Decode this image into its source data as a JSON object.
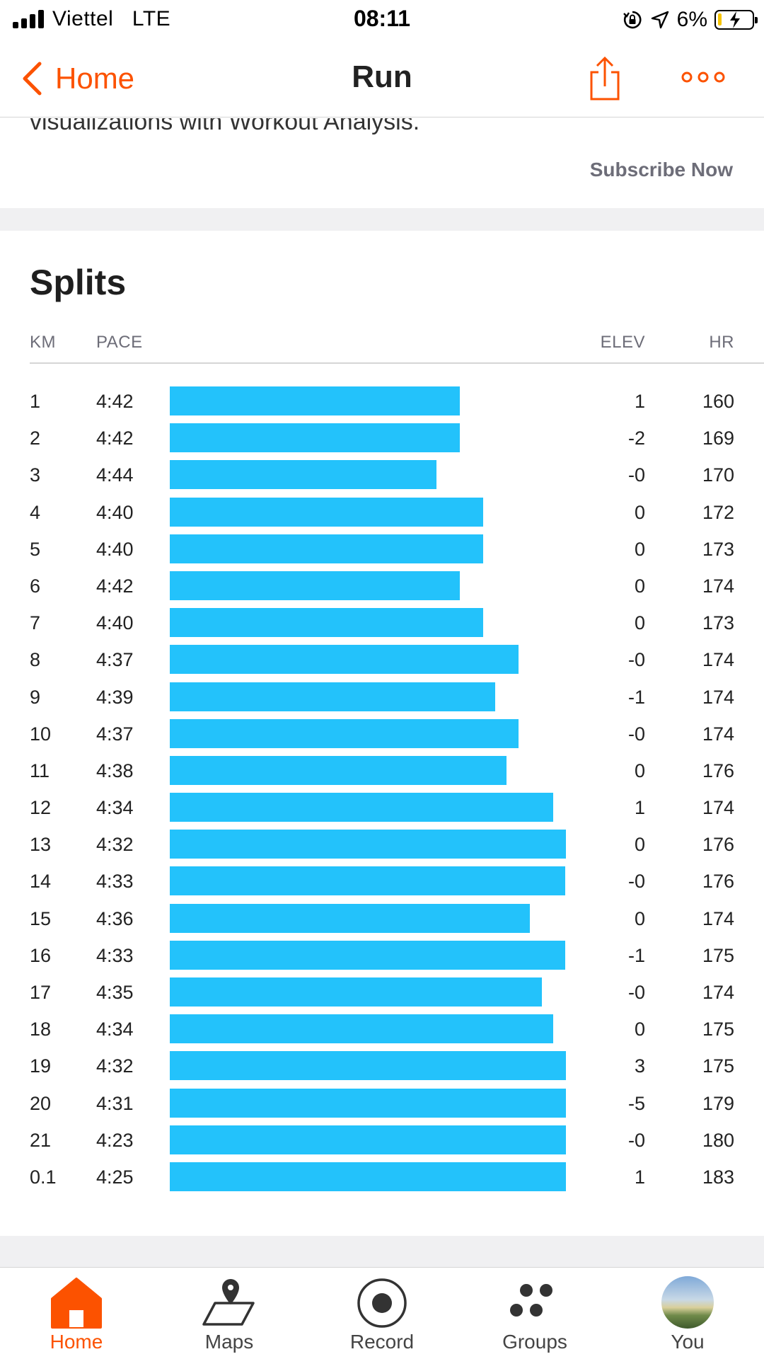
{
  "status_bar": {
    "carrier": "Viettel",
    "network": "LTE",
    "time": "08:11",
    "battery_percent": "6%"
  },
  "nav": {
    "back_label": "Home",
    "title": "Run",
    "share_icon": "share-icon",
    "more_icon": "more-icon"
  },
  "promo": {
    "text": "visualizations with Workout Analysis.",
    "subscribe_label": "Subscribe Now"
  },
  "splits": {
    "title": "Splits",
    "columns": {
      "km": "KM",
      "pace": "PACE",
      "elev": "ELEV",
      "hr": "HR"
    },
    "bar_color": "#23c2fb",
    "rows": [
      {
        "km": "1",
        "pace": "4:42",
        "elev": "1",
        "hr": "160"
      },
      {
        "km": "2",
        "pace": "4:42",
        "elev": "-2",
        "hr": "169"
      },
      {
        "km": "3",
        "pace": "4:44",
        "elev": "-0",
        "hr": "170"
      },
      {
        "km": "4",
        "pace": "4:40",
        "elev": "0",
        "hr": "172"
      },
      {
        "km": "5",
        "pace": "4:40",
        "elev": "0",
        "hr": "173"
      },
      {
        "km": "6",
        "pace": "4:42",
        "elev": "0",
        "hr": "174"
      },
      {
        "km": "7",
        "pace": "4:40",
        "elev": "0",
        "hr": "173"
      },
      {
        "km": "8",
        "pace": "4:37",
        "elev": "-0",
        "hr": "174"
      },
      {
        "km": "9",
        "pace": "4:39",
        "elev": "-1",
        "hr": "174"
      },
      {
        "km": "10",
        "pace": "4:37",
        "elev": "-0",
        "hr": "174"
      },
      {
        "km": "11",
        "pace": "4:38",
        "elev": "0",
        "hr": "176"
      },
      {
        "km": "12",
        "pace": "4:34",
        "elev": "1",
        "hr": "174"
      },
      {
        "km": "13",
        "pace": "4:32",
        "elev": "0",
        "hr": "176"
      },
      {
        "km": "14",
        "pace": "4:33",
        "elev": "-0",
        "hr": "176"
      },
      {
        "km": "15",
        "pace": "4:36",
        "elev": "0",
        "hr": "174"
      },
      {
        "km": "16",
        "pace": "4:33",
        "elev": "-1",
        "hr": "175"
      },
      {
        "km": "17",
        "pace": "4:35",
        "elev": "-0",
        "hr": "174"
      },
      {
        "km": "18",
        "pace": "4:34",
        "elev": "0",
        "hr": "175"
      },
      {
        "km": "19",
        "pace": "4:32",
        "elev": "3",
        "hr": "175"
      },
      {
        "km": "20",
        "pace": "4:31",
        "elev": "-5",
        "hr": "179"
      },
      {
        "km": "21",
        "pace": "4:23",
        "elev": "-0",
        "hr": "180"
      },
      {
        "km": "0.1",
        "pace": "4:25",
        "elev": "1",
        "hr": "183"
      }
    ]
  },
  "tab_bar": {
    "accent_color": "#fc5200",
    "tabs": [
      {
        "label": "Home",
        "icon": "home-icon"
      },
      {
        "label": "Maps",
        "icon": "maps-icon"
      },
      {
        "label": "Record",
        "icon": "record-icon"
      },
      {
        "label": "Groups",
        "icon": "groups-icon"
      },
      {
        "label": "You",
        "icon": "avatar"
      }
    ]
  }
}
